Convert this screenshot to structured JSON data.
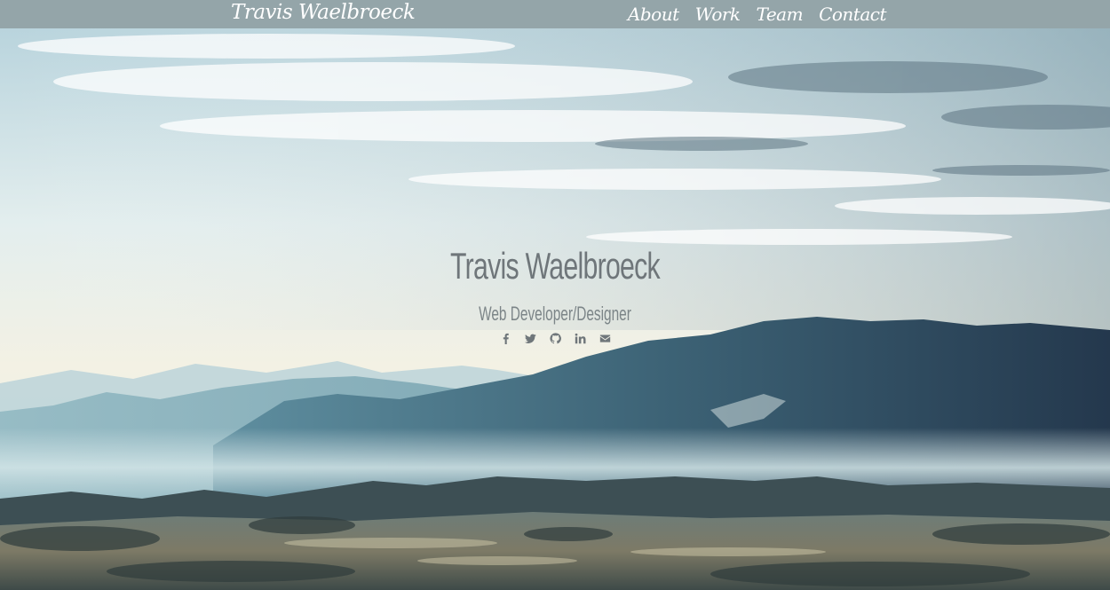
{
  "navbar": {
    "brand": "Travis Waelbroeck",
    "links": [
      {
        "label": "About"
      },
      {
        "label": "Work"
      },
      {
        "label": "Team"
      },
      {
        "label": "Contact"
      }
    ],
    "background_color": "#94a5a9"
  },
  "hero": {
    "title": "Travis Waelbroeck",
    "subtitle": "Web Developer/Designer",
    "social_icons": [
      "facebook-icon",
      "twitter-icon",
      "github-icon",
      "linkedin-icon",
      "envelope-icon"
    ],
    "icon_color": "#6f767a"
  }
}
